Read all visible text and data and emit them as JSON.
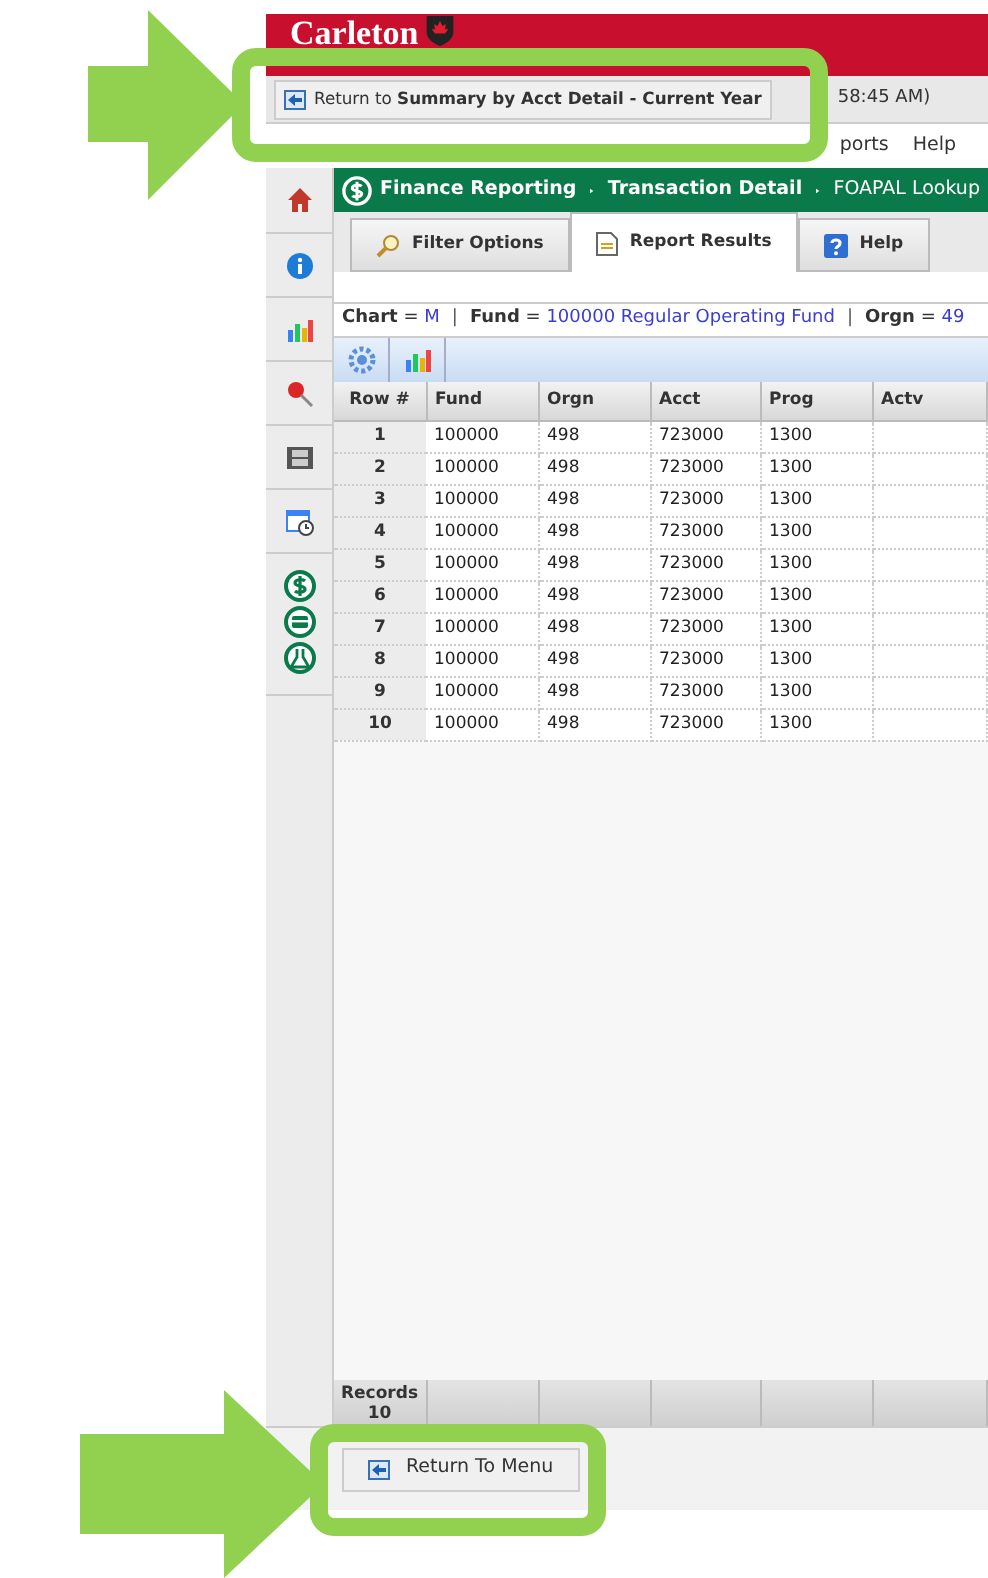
{
  "header": {
    "logo": "Carleton"
  },
  "toolbar": {
    "return_button": {
      "prefix": "Return to ",
      "target": "Summary by Acct Detail - Current Year"
    },
    "time": "58:45 AM)"
  },
  "menu": [
    "ports",
    "Help"
  ],
  "breadcrumb": [
    "Finance Reporting",
    "Transaction Detail",
    "FOAPAL Lookup"
  ],
  "tabs": [
    {
      "label": "Filter Options",
      "selected": false
    },
    {
      "label": "Report Results",
      "selected": true
    },
    {
      "label": "Help",
      "selected": false
    }
  ],
  "filters": [
    {
      "label": "Chart",
      "operator": "=",
      "value": "M"
    },
    {
      "separator": "|",
      "label": "Fund",
      "operator": "=",
      "value": "100000 Regular Operating Fund"
    },
    {
      "separator": "|",
      "label": "Orgn",
      "operator": "=",
      "value": "49"
    }
  ],
  "table": {
    "columns": [
      "Row #",
      "Fund",
      "Orgn",
      "Acct",
      "Prog",
      "Actv"
    ],
    "rows": [
      [
        "1",
        "100000",
        "498",
        "723000",
        "1300",
        ""
      ],
      [
        "2",
        "100000",
        "498",
        "723000",
        "1300",
        ""
      ],
      [
        "3",
        "100000",
        "498",
        "723000",
        "1300",
        ""
      ],
      [
        "4",
        "100000",
        "498",
        "723000",
        "1300",
        ""
      ],
      [
        "5",
        "100000",
        "498",
        "723000",
        "1300",
        ""
      ],
      [
        "6",
        "100000",
        "498",
        "723000",
        "1300",
        ""
      ],
      [
        "7",
        "100000",
        "498",
        "723000",
        "1300",
        ""
      ],
      [
        "8",
        "100000",
        "498",
        "723000",
        "1300",
        ""
      ],
      [
        "9",
        "100000",
        "498",
        "723000",
        "1300",
        ""
      ],
      [
        "10",
        "100000",
        "498",
        "723000",
        "1300",
        ""
      ]
    ],
    "footer": {
      "label": "Records",
      "count": "10"
    }
  },
  "bottom_button": "Return To Menu"
}
